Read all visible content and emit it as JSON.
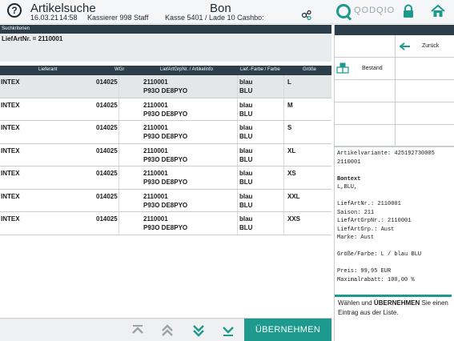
{
  "header": {
    "app_title": "Artikelsuche",
    "date": "16.03.21",
    "time": "14:58",
    "cashier": "Kassierer 998 Staff",
    "mode": "Bon",
    "register": "Kasse 5401 / Lade 10 Cashbo:",
    "logo_text": "QODQIO"
  },
  "criteria": {
    "section_label": "Suchkriterien",
    "value": "LiefArtNr. = 2110001"
  },
  "table": {
    "columns": [
      "Lieferant",
      "WGr",
      "LiefArtGrpNr. / Artikelinfo",
      "Lief.-Farbe / Farbe",
      "Größe"
    ],
    "rows": [
      {
        "lieferant": "INTEX",
        "wgr": "014025",
        "art1": "2110001",
        "art2": "P93O DE8PYO",
        "farbe1": "blau",
        "farbe2": "BLU",
        "groesse": "L"
      },
      {
        "lieferant": "INTEX",
        "wgr": "014025",
        "art1": "2110001",
        "art2": "P93O DE8PYO",
        "farbe1": "blau",
        "farbe2": "BLU",
        "groesse": "M"
      },
      {
        "lieferant": "INTEX",
        "wgr": "014025",
        "art1": "2110001",
        "art2": "P93O DE8PYO",
        "farbe1": "blau",
        "farbe2": "BLU",
        "groesse": "S"
      },
      {
        "lieferant": "INTEX",
        "wgr": "014025",
        "art1": "2110001",
        "art2": "P93O DE8PYO",
        "farbe1": "blau",
        "farbe2": "BLU",
        "groesse": "XL"
      },
      {
        "lieferant": "INTEX",
        "wgr": "014025",
        "art1": "2110001",
        "art2": "P93O DE8PYO",
        "farbe1": "blau",
        "farbe2": "BLU",
        "groesse": "XS"
      },
      {
        "lieferant": "INTEX",
        "wgr": "014025",
        "art1": "2110001",
        "art2": "P93O DE8PYO",
        "farbe1": "blau",
        "farbe2": "BLU",
        "groesse": "XXL"
      },
      {
        "lieferant": "INTEX",
        "wgr": "014025",
        "art1": "2110001",
        "art2": "P93O DE8PYO",
        "farbe1": "blau",
        "farbe2": "BLU",
        "groesse": "XXS"
      }
    ]
  },
  "right_panel": {
    "back_label": "Zurück",
    "stock_label": "Bestand",
    "info_lines": [
      "Artikelvariante: 425192730005",
      "2110001",
      "",
      "Bontext",
      "L,BLU,",
      "",
      "LiefArtNr.: 2110001",
      "Saison: 211",
      "LiefArtGrpNr.: 2110001",
      "LiefArtGrp.: Aust",
      "Marke: Aust",
      "",
      "Größe/Farbe: L / blau BLU",
      "",
      "Preis: 99,95 EUR",
      "Maximalrabatt: 100,00 %"
    ],
    "hint_pre": "Wählen und ",
    "hint_bold": "ÜBERNEHMEN",
    "hint_post": " Sie einen Eintrag aus der Liste."
  },
  "footer": {
    "accept_label": "ÜBERNEHMEN"
  },
  "colors": {
    "accent": "#1d9a8d",
    "dark_bar": "#2d3e4b"
  }
}
